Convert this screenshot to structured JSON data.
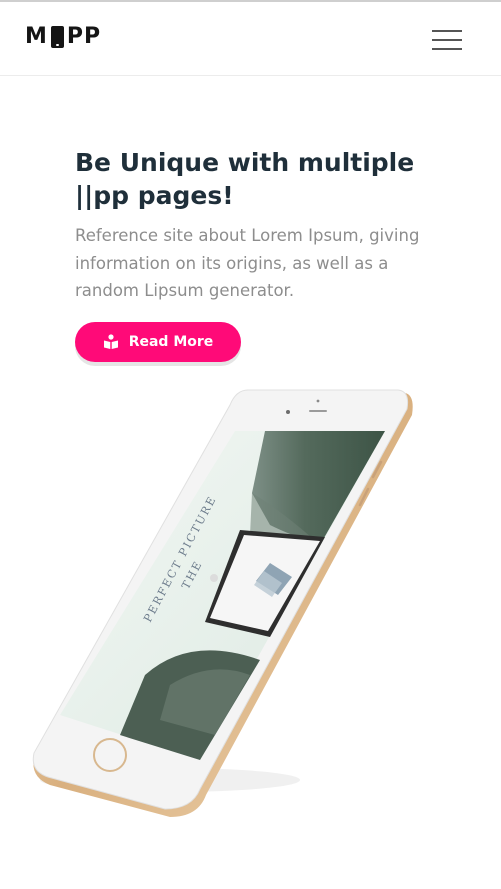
{
  "header": {
    "logo_left": "M",
    "logo_right": "PP",
    "menu_icon": "hamburger-menu-icon"
  },
  "hero": {
    "title": "Be Unique with multiple ||pp pages!",
    "description": "Reference site about Lorem Ipsum, giving information on its origins, as well as a random Lipsum generator.",
    "button_label": "Read More",
    "button_icon": "book-reader-icon"
  },
  "mockup": {
    "screen_text_line1": "THE",
    "screen_text_line2": "PERFECT PICTURE",
    "device_icon": "smartphone-icon"
  },
  "colors": {
    "accent": "#ff0a78",
    "heading": "#1f2f3a",
    "body_text": "#8d8d8d",
    "phone_gold": "#e6c49a"
  }
}
